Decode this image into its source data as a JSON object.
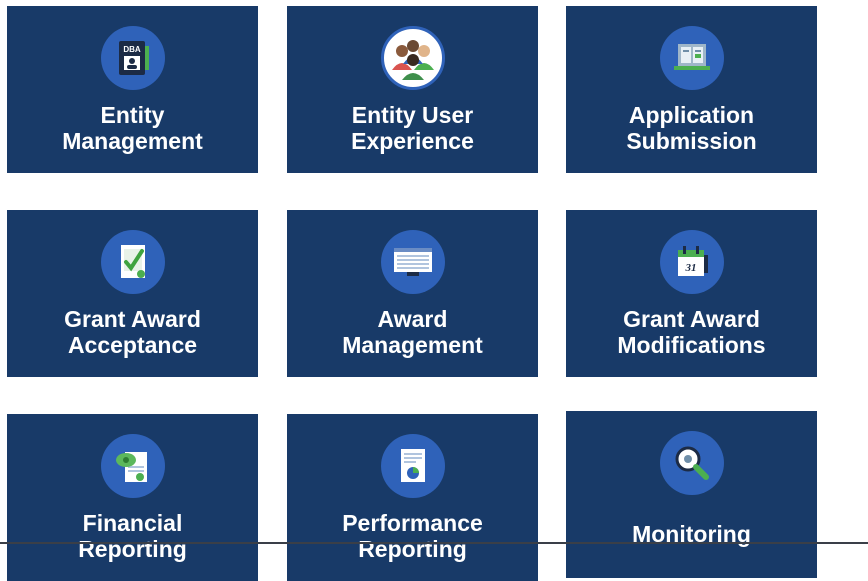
{
  "tiles": [
    {
      "icon": "dba-badge-icon",
      "lines": [
        "Entity",
        "Management"
      ]
    },
    {
      "icon": "users-group-icon",
      "lines": [
        "Entity User",
        "Experience"
      ]
    },
    {
      "icon": "laptop-document-icon",
      "lines": [
        "Application",
        "Submission"
      ]
    },
    {
      "icon": "checked-document-icon",
      "lines": [
        "Grant Award",
        "Acceptance"
      ]
    },
    {
      "icon": "monitor-table-icon",
      "lines": [
        "Award",
        "Management"
      ]
    },
    {
      "icon": "calendar-icon",
      "lines": [
        "Grant Award",
        "Modifications"
      ]
    },
    {
      "icon": "money-document-icon",
      "lines": [
        "Financial",
        "Reporting"
      ]
    },
    {
      "icon": "report-chart-icon",
      "lines": [
        "Performance",
        "Reporting"
      ]
    },
    {
      "icon": "magnifier-gear-icon",
      "lines": [
        "Monitoring"
      ]
    }
  ],
  "colors": {
    "tile": "#183a68",
    "icon_circle": "#2f62b9",
    "text": "#ffffff"
  }
}
